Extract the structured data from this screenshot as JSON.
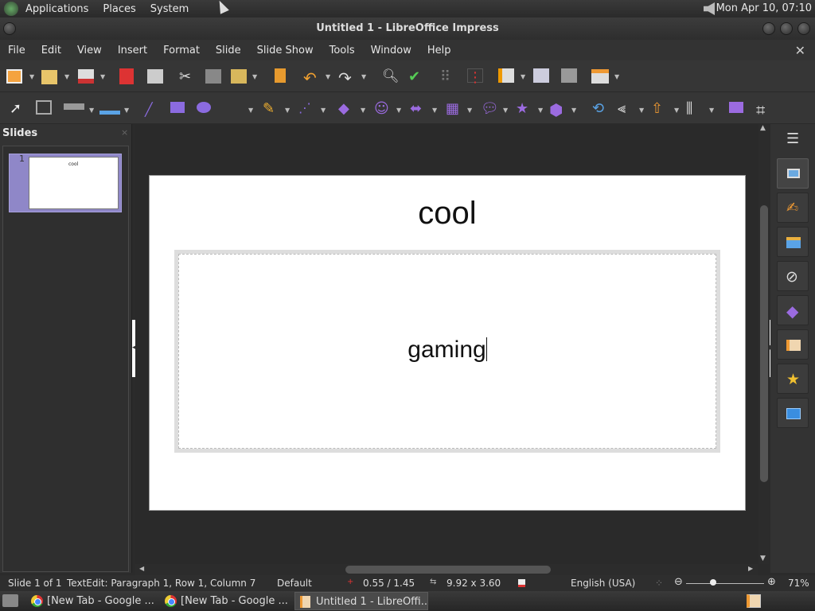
{
  "top_panel": {
    "menus": [
      "Applications",
      "Places",
      "System"
    ],
    "clock": "Mon Apr 10, 07:10"
  },
  "window": {
    "title": "Untitled 1 - LibreOffice Impress"
  },
  "menubar": {
    "items": [
      "File",
      "Edit",
      "View",
      "Insert",
      "Format",
      "Slide",
      "Slide Show",
      "Tools",
      "Window",
      "Help"
    ],
    "close_glyph": "✕"
  },
  "slides_pane": {
    "title": "Slides",
    "thumbnails": [
      {
        "number": "1",
        "text": "cool"
      }
    ]
  },
  "slide": {
    "title": "cool",
    "body": "gaming"
  },
  "statusbar": {
    "slide_position": "Slide 1 of 1",
    "edit_status": "TextEdit: Paragraph 1, Row 1, Column 7",
    "master": "Default",
    "position": "0.55 / 1.45",
    "size": "9.92 x 3.60",
    "language": "English (USA)",
    "zoom": "71%",
    "zoom_level": 0.71
  },
  "taskbar": {
    "tasks": [
      {
        "label": "[New Tab - Google ...",
        "active": false
      },
      {
        "label": "[New Tab - Google ...",
        "active": false
      },
      {
        "label": "Untitled 1 - LibreOffi...",
        "active": true
      }
    ]
  },
  "colors": {
    "selection": "#8f87c8",
    "accent_red": "#d33",
    "sidebar_purple": "#9b6be0"
  }
}
